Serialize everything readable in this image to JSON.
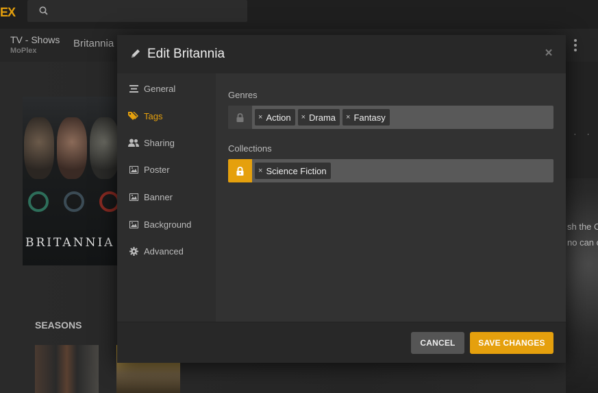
{
  "app": {
    "logo_text": "EX",
    "brand_color": "#e5a00d"
  },
  "search": {
    "placeholder": ""
  },
  "header": {
    "section_title": "TV - Shows",
    "section_subtitle": "MoPlex",
    "show_title": "Britannia"
  },
  "background": {
    "poster_title": "BRITANNIA",
    "seasons_label": "SEASONS",
    "right_text_1": "sh the C",
    "right_text_2": "no can c",
    "dots": "· · ·"
  },
  "modal": {
    "title": "Edit Britannia",
    "close_symbol": "×",
    "nav": [
      {
        "label": "General",
        "icon": "list-icon",
        "active": false
      },
      {
        "label": "Tags",
        "icon": "tag-icon",
        "active": true
      },
      {
        "label": "Sharing",
        "icon": "users-icon",
        "active": false
      },
      {
        "label": "Poster",
        "icon": "image-icon",
        "active": false
      },
      {
        "label": "Banner",
        "icon": "image-icon",
        "active": false
      },
      {
        "label": "Background",
        "icon": "image-icon",
        "active": false
      },
      {
        "label": "Advanced",
        "icon": "gear-icon",
        "active": false
      }
    ],
    "genres": {
      "label": "Genres",
      "locked": false,
      "tags": [
        "Action",
        "Drama",
        "Fantasy"
      ]
    },
    "collections": {
      "label": "Collections",
      "locked": true,
      "tags": [
        "Science Fiction"
      ]
    },
    "tag_remove_symbol": "×",
    "footer": {
      "cancel_label": "CANCEL",
      "save_label": "SAVE CHANGES"
    }
  }
}
